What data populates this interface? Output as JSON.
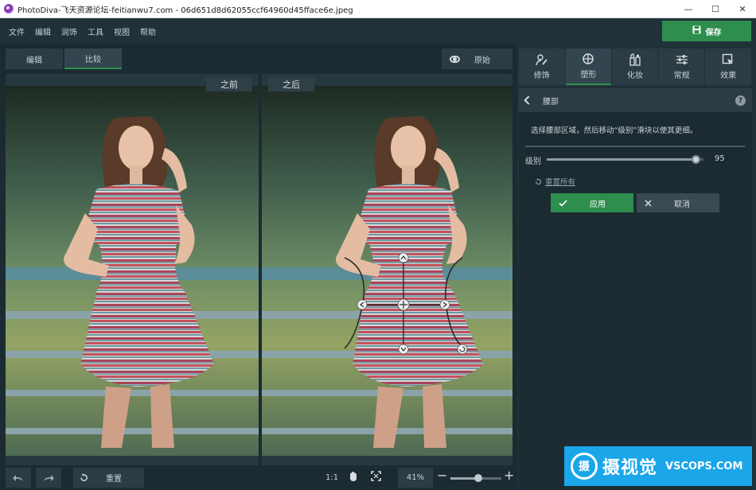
{
  "window": {
    "title": "PhotoDiva-飞天资源论坛-feitianwu7.com - 06d651d8d62055ccf64960d45fface6e.jpeg",
    "minimize": "—",
    "maximize": "☐",
    "close": "✕"
  },
  "menu": [
    "文件",
    "编辑",
    "润饰",
    "工具",
    "视图",
    "帮助"
  ],
  "save_button": "保存",
  "view_tabs": [
    "编辑",
    "比较"
  ],
  "active_view_tab": "比较",
  "original_button": "原始",
  "before_label": "之前",
  "after_label": "之后",
  "bottom": {
    "reset": "重置",
    "ratio": "1:1",
    "zoom": "41%",
    "zoom_fraction": 0.55
  },
  "tool_tabs": [
    {
      "label": "修饰",
      "icon": "retouch-icon"
    },
    {
      "label": "塑形",
      "icon": "shaping-icon"
    },
    {
      "label": "化妆",
      "icon": "makeup-icon"
    },
    {
      "label": "常规",
      "icon": "sliders-icon"
    },
    {
      "label": "效果",
      "icon": "effects-icon"
    }
  ],
  "active_tool_tab": "塑形",
  "section": {
    "title": "腰部",
    "help": "?",
    "instruction": "选择腰部区域，然后移动“级别”滑块以使其更细。",
    "level_label": "级别",
    "level_value": "95",
    "level_fraction": 0.95,
    "reset_all": "重置所有",
    "apply": "应用",
    "cancel": "取消"
  },
  "watermark": {
    "logo_char": "摄",
    "cn": "摄视觉",
    "en": "VSCOPS.COM"
  }
}
